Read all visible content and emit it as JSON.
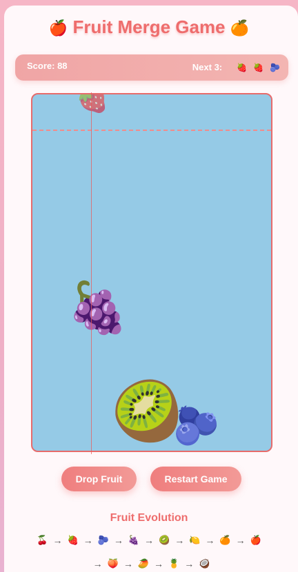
{
  "header": {
    "title": "Fruit Merge Game",
    "emoji_left": "🍎",
    "emoji_right": "🍊"
  },
  "status": {
    "score_text": "Score: 88",
    "next_label": "Next 3:",
    "next_fruits": [
      "🍓",
      "🍓",
      "🫐"
    ]
  },
  "board": {
    "fruits": [
      {
        "name": "strawberry",
        "emoji": "🍓"
      },
      {
        "name": "grapes",
        "emoji": "🍇"
      },
      {
        "name": "kiwi",
        "emoji": "🥝"
      },
      {
        "name": "blueberries",
        "emoji": "🫐"
      }
    ]
  },
  "buttons": {
    "drop": "Drop Fruit",
    "restart": "Restart Game"
  },
  "evolution": {
    "title": "Fruit Evolution",
    "arrow": "→",
    "row1": [
      "🍒",
      "🍓",
      "🫐",
      "🍇",
      "🥝",
      "🍋",
      "🍊",
      "🍎"
    ],
    "row2": [
      "🍑",
      "🥭",
      "🍍",
      "🥥"
    ]
  },
  "colors": {
    "accent": "#ee6d6d",
    "board_bg": "#95cae6",
    "page_bg": "#f6b6c6"
  }
}
